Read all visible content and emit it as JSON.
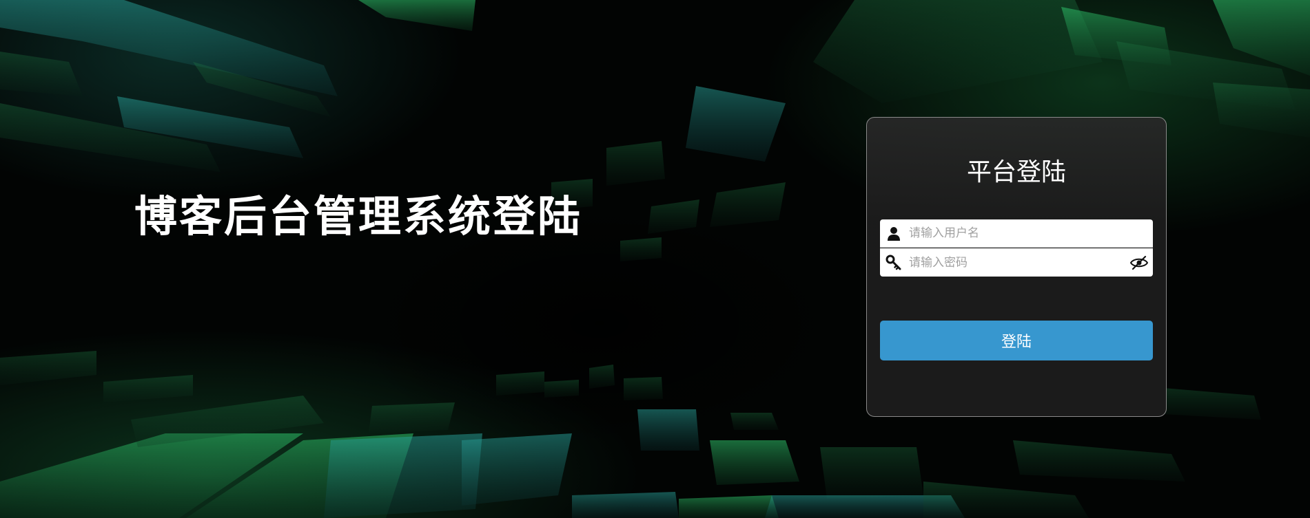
{
  "page": {
    "headline": "博客后台管理系统登陆"
  },
  "login": {
    "title": "平台登陆",
    "username": {
      "value": "",
      "placeholder": "请输入用户名",
      "icon": "user-icon"
    },
    "password": {
      "value": "",
      "placeholder": "请输入密码",
      "icon": "key-icon",
      "toggle_icon": "eye-slash-icon"
    },
    "submit_label": "登陆"
  },
  "colors": {
    "background": "#000000",
    "card_background": "#1b1b1b",
    "card_border": "#8b8b8b",
    "button": "#3797cf",
    "accent_green": "#2ec26a",
    "accent_teal": "#2aa8a0"
  }
}
